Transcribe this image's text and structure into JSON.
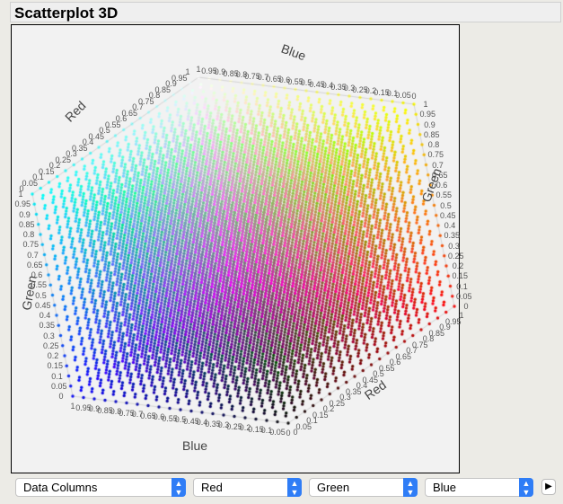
{
  "title": "Scatterplot 3D",
  "plot": {
    "axis_titles": {
      "red": "Red",
      "green": "Green",
      "blue": "Blue"
    },
    "ticks": [
      "0",
      "0.05",
      "0.1",
      "0.15",
      "0.2",
      "0.25",
      "0.3",
      "0.35",
      "0.4",
      "0.45",
      "0.5",
      "0.55",
      "0.6",
      "0.65",
      "0.7",
      "0.75",
      "0.8",
      "0.85",
      "0.9",
      "0.95",
      "1"
    ]
  },
  "controls": {
    "source": "Data Columns",
    "x_column": "Red",
    "y_column": "Green",
    "z_column": "Blue",
    "go_icon": "arrow-right-icon"
  }
}
